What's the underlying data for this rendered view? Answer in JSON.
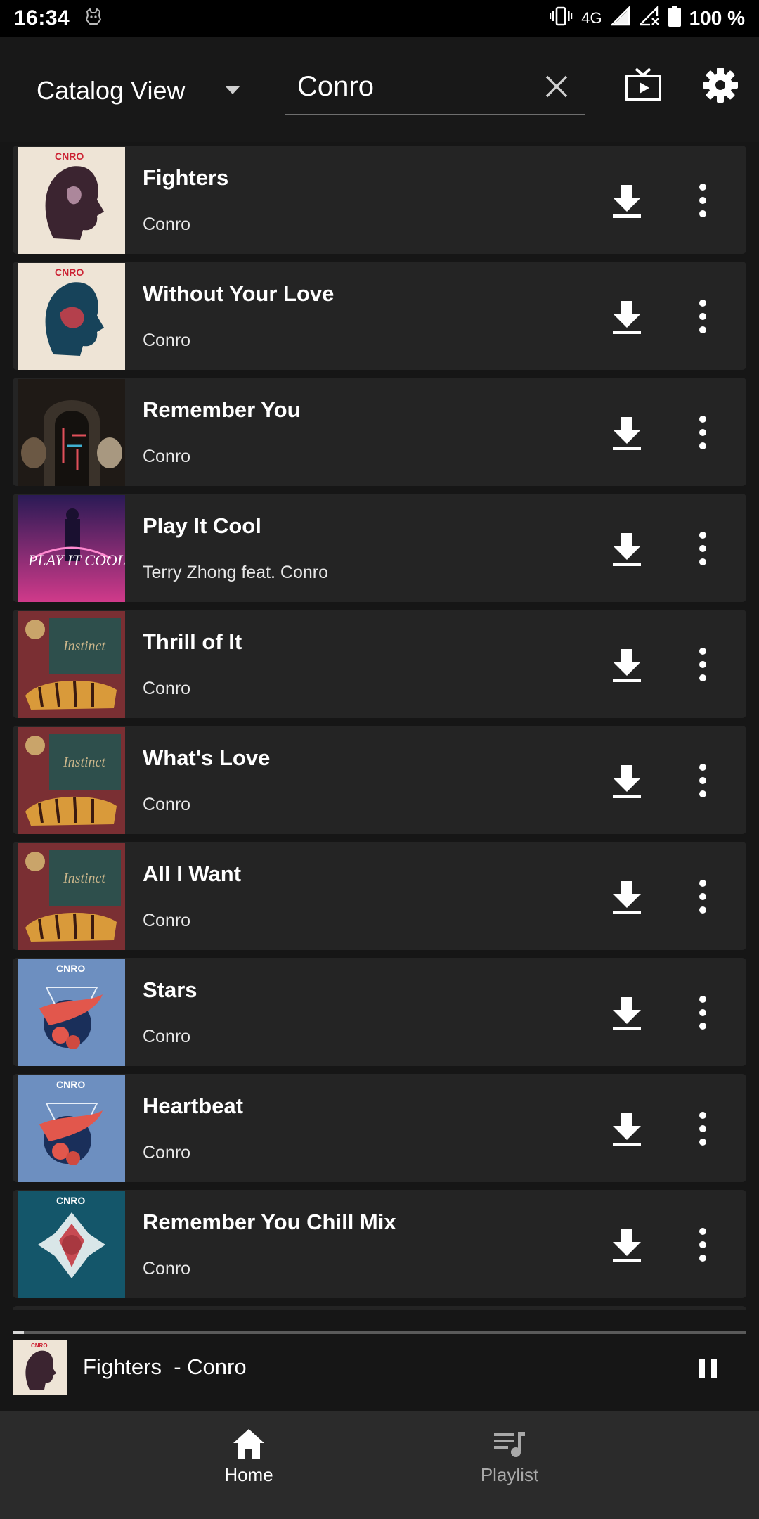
{
  "status_bar": {
    "time": "16:34",
    "network": "4G",
    "battery": "100 %",
    "icons": [
      "app-notification-icon",
      "vibrate-icon",
      "signal-icon",
      "signal-no-data-icon",
      "battery-icon"
    ]
  },
  "header": {
    "view_selector": "Catalog View",
    "search_value": "Conro",
    "icons": [
      "chevron-down-icon",
      "close-icon",
      "cast-icon",
      "gear-icon"
    ]
  },
  "tracks": [
    {
      "title": "Fighters",
      "artist": "Conro"
    },
    {
      "title": "Without Your Love",
      "artist": "Conro"
    },
    {
      "title": "Remember You",
      "artist": "Conro"
    },
    {
      "title": "Play It Cool",
      "artist": "Terry Zhong feat. Conro"
    },
    {
      "title": "Thrill of It",
      "artist": "Conro"
    },
    {
      "title": "What's Love",
      "artist": "Conro"
    },
    {
      "title": "All I Want",
      "artist": "Conro"
    },
    {
      "title": "Stars",
      "artist": "Conro"
    },
    {
      "title": "Heartbeat",
      "artist": "Conro"
    },
    {
      "title": "Remember You Chill Mix",
      "artist": "Conro"
    }
  ],
  "now_playing": {
    "title": "Fighters  - Conro",
    "progress": 0.015
  },
  "bottom_nav": {
    "home": "Home",
    "playlist": "Playlist"
  },
  "colors": {
    "background": "#161616",
    "row": "#242424",
    "nav": "#2b2b2b",
    "active": "#ffffff",
    "inactive": "#a9a9a9"
  }
}
